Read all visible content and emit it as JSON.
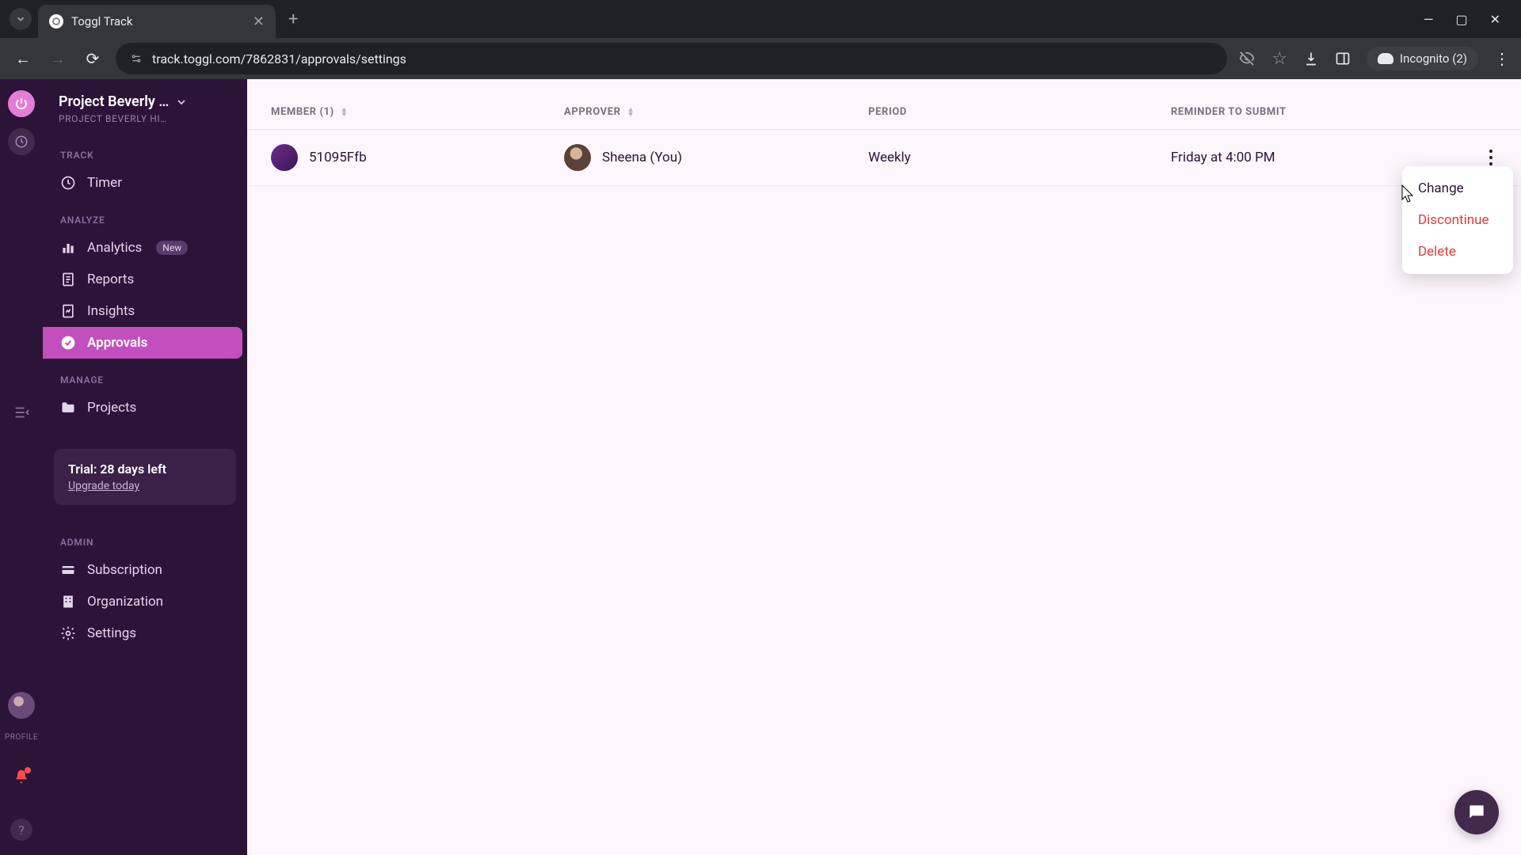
{
  "browser": {
    "tab_title": "Toggl Track",
    "url": "track.toggl.com/7862831/approvals/settings",
    "incognito_label": "Incognito (2)"
  },
  "rail": {
    "profile_label": "PROFILE"
  },
  "sidebar": {
    "workspace_name": "Project Beverly …",
    "workspace_sub": "PROJECT BEVERLY HI…",
    "sections": {
      "track": "TRACK",
      "analyze": "ANALYZE",
      "manage": "MANAGE",
      "admin": "ADMIN"
    },
    "items": {
      "timer": "Timer",
      "analytics": "Analytics",
      "analytics_badge": "New",
      "reports": "Reports",
      "insights": "Insights",
      "approvals": "Approvals",
      "projects": "Projects",
      "subscription": "Subscription",
      "organization": "Organization",
      "settings": "Settings"
    },
    "trial": {
      "title": "Trial: 28 days left",
      "link": "Upgrade today"
    }
  },
  "table": {
    "headers": {
      "member": "MEMBER (1)",
      "approver": "APPROVER",
      "period": "PERIOD",
      "reminder": "REMINDER TO SUBMIT"
    },
    "row": {
      "member": "51095Ffb",
      "approver": "Sheena (You)",
      "period": "Weekly",
      "reminder": "Friday at 4:00 PM"
    }
  },
  "context_menu": {
    "change": "Change",
    "discontinue": "Discontinue",
    "delete": "Delete"
  }
}
